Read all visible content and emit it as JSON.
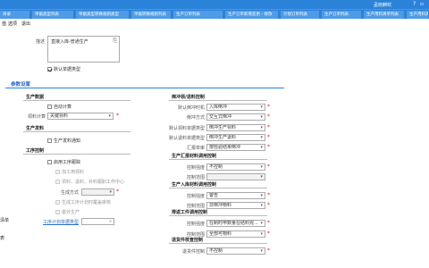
{
  "header": {
    "user_text": "孟晓麒欢",
    "glyphs": [
      "?",
      "▫"
    ]
  },
  "tabs": [
    "目录",
    "单据类型列表",
    "单据类型转换规则类型",
    "单据转换规则列表",
    "生产订单列表",
    "生产订单新增变更 - 修改",
    "计划订单列表",
    "生产订单列表",
    "生产用料清单列表",
    "生产用料清单 - 修"
  ],
  "menu": [
    "值",
    "选项",
    "退出"
  ],
  "description": {
    "label": "描述",
    "value": "直接入库-普通生产"
  },
  "default_type": {
    "label": "默认单据类型",
    "checked": true
  },
  "param_tab": "参数设置",
  "left": {
    "production_data": {
      "title": "生产数据",
      "auto_calc": "自动计算",
      "material_group_label": "领料计算",
      "material_group_value": "关键领料"
    },
    "production_release": {
      "title": "生产发料",
      "notice": "生产发料通知"
    },
    "process_control": {
      "title": "工序控制",
      "enable": "启用工序跟踪",
      "add_material": "加工用领料",
      "pick_feed": "领料、退料、补料跟职工作中心",
      "gen_method_label": "生成方式",
      "gen_plan": "生成工序计划时覆盖审核",
      "outsource": "委外生产",
      "plan_type_label": "工序计划单据类型"
    },
    "side_labels": [
      "清单",
      "表"
    ]
  },
  "right": {
    "backflush": {
      "title": "倒冲领/退料控制",
      "default_time_label": "默认倒冲时机",
      "default_time_value": "入库倒冲",
      "method_label": "倒冲方式",
      "method_value": "交互式倒冲",
      "pick_type_label": "默认领料单据类型",
      "pick_type_value": "倒冲生产领料",
      "return_type_label": "默认退料单据类型",
      "return_type_value": "倒冲生产退料",
      "report_label": "汇报单审",
      "report_value": "按检验结果倒冲"
    },
    "report_control": {
      "title": "生产汇报材料调用控制",
      "qty_label": "控制强度",
      "qty_value": "不控制",
      "range_label": "控制范围",
      "range_value": ""
    },
    "inbound_control": {
      "title": "生产入库材料调用控制",
      "qty_label": "控制强度",
      "qty_value": "警告",
      "range_label": "控制范围",
      "range_value": "非倒冲物料"
    },
    "rework": {
      "title": "排返工件调用控制",
      "qty_label": "控制强度",
      "qty_value": "在制时申数量在结料完...",
      "range_label": "控制范围",
      "range_value": "全部可物料"
    },
    "return_control": {
      "title": "退货件核查控制",
      "qty_label": "退货件控制",
      "qty_value": "不控制"
    }
  }
}
